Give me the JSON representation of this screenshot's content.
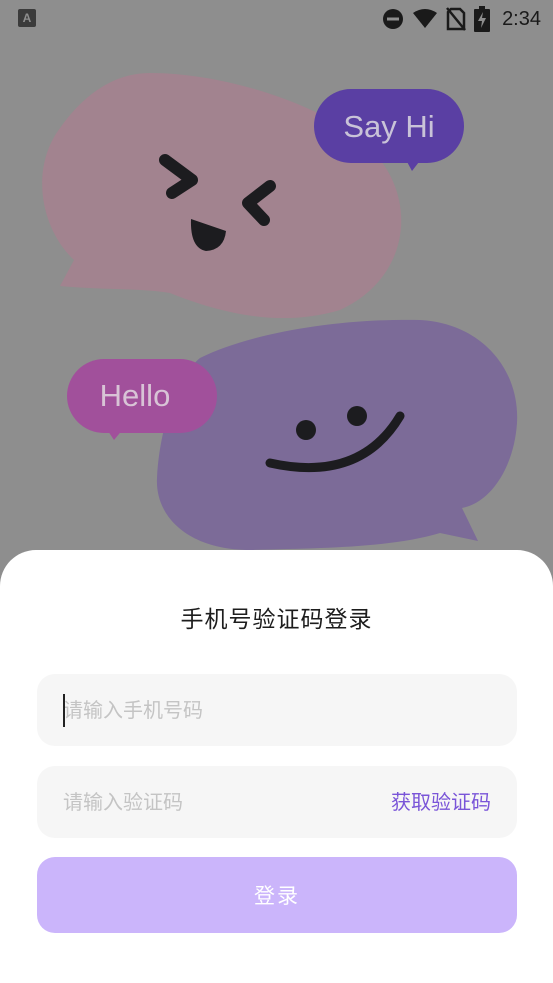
{
  "status_bar": {
    "time": "2:34",
    "left_icon": "accessibility-a-icon",
    "icons": [
      "do-not-disturb-icon",
      "wifi-icon",
      "no-sim-icon",
      "battery-charging-icon"
    ]
  },
  "illustration": {
    "bubble_top_text": "Say Hi",
    "bubble_bottom_text": "Hello",
    "colors": {
      "pink_bubble": "#a2838f",
      "purple_big_bubble": "#7c6b98",
      "say_hi_bubble": "#5a3fa3",
      "hello_bubble": "#a1509b",
      "overlay": "#8e8e8e"
    }
  },
  "login": {
    "title": "手机号验证码登录",
    "phone_placeholder": "请输入手机号码",
    "code_placeholder": "请输入验证码",
    "get_code_label": "获取验证码",
    "login_button": "登录",
    "colors": {
      "accent": "#7a55d8",
      "button_disabled": "#cbb5fb",
      "field_bg": "#f6f6f6"
    }
  }
}
